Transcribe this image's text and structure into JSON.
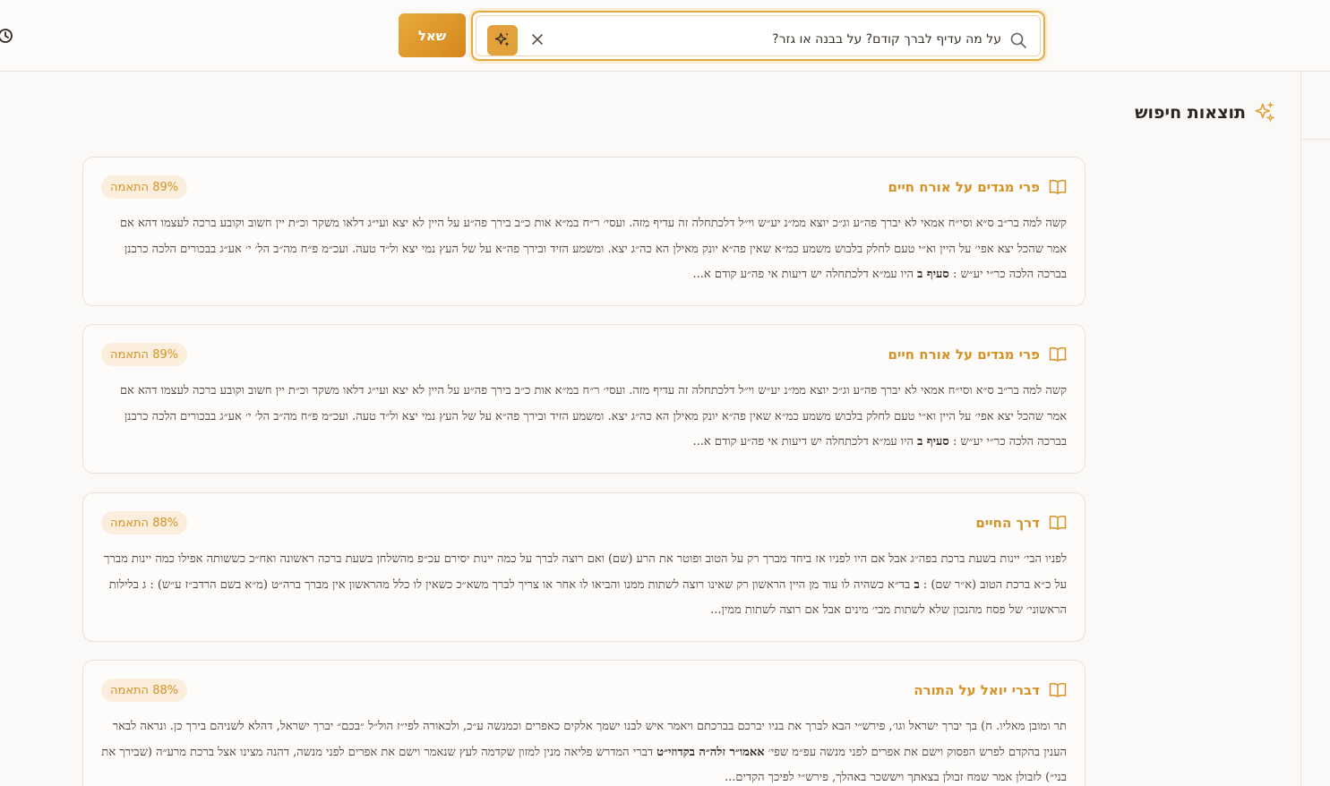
{
  "header": {
    "ask_label": "שאל",
    "search_value": "על מה עדיף לברך קודם? על בבנה או גזר?"
  },
  "results": {
    "title": "תוצאות חיפוש",
    "items": [
      {
        "title": "פרי מגדים על אורח חיים",
        "match": "89% התאמה",
        "snippet_before": "קשה למה בר״ב ס״א וסי״ח אמאי לא יברך פה״ע וג״כ יוצא ממ״נ יע״ש וי״ל דלכתחלה זה עדיף מזה. ועסי׳ ר״ח במ״א אות כ״ב בירך פה״ע על היין לא יצא ועי״ג דלאו משקר וכ״ת יין חשוב וקובע ברכה לעצמו דהא אם אמר שהכל יצא אפי׳ על היין וא״י טעם לחלק בלבוש משמע כמ״א שאין פה״א יונק מאילן הא כה״ג יצא. ומשמע הזיד ובירך פה״א על של העץ נמי יצא ול״ד טעה. ועכ״מ פ״ח מה״ב הל׳ י׳ אע״ג בבכורים הלכה כרבנן בברכה הלכה כר״י יע״ש : ",
        "snippet_bold": "סעיף ב",
        "snippet_after": " היו עמ״א דלכתחלה יש דיעות אי פה״ע קודם א..."
      },
      {
        "title": "פרי מגדים על אורח חיים",
        "match": "89% התאמה",
        "snippet_before": "קשה למה בר״ב ס״א וסי״ח אמאי לא יברך פה״ע וג״כ יוצא ממ״נ יע״ש וי״ל דלכתחלה זה עדיף מזה. ועסי׳ ר״ח במ״א אות כ״ב בירך פה״ע על היין לא יצא ועי״ג דלאו משקר וכ״ת יין חשוב וקובע ברכה לעצמו דהא אם אמר שהכל יצא אפי׳ על היין וא״י טעם לחלק בלבוש משמע כמ״א שאין פה״א יונק מאילן הא כה״ג יצא. ומשמע הזיד ובירך פה״א על של העץ נמי יצא ול״ד טעה. ועכ״מ פ״ח מה״ב הל׳ י׳ אע״ג בבכורים הלכה כרבנן בברכה הלכה כר״י יע״ש : ",
        "snippet_bold": "סעיף ב",
        "snippet_after": " היו עמ״א דלכתחלה יש דיעות אי פה״ע קודם א..."
      },
      {
        "title": "דרך החיים",
        "match": "88% התאמה",
        "snippet_before": "לפניו הבי׳ יינות בשעת ברכת בפה״ג אבל אם היו לפניו אז ביחד מברך רק על הטוב ופוטר את הרע (שם) ואם רוצה לברך על כמה יינות יסירם עכ״פ מהשלחן בשעת ברכה ראשונה ואח״כ כששותה אפילו כמה יינות מברך על כ״א ברכת הטוב (א״ר שם) : ",
        "snippet_bold": "ב",
        "snippet_after": " בד״א כשהיה לו עוד מן היין הראשון רק שאינו רוצה לשתות ממנו והביאו לו אחר או צריך לברך משא״כ כשאין לו כלל מהראשון אין מברך ברה״ט (מ״א בשם הרדב״ז ע״ש) : ג בלילות הראשוני׳ של פסח מהנכון שלא לשתות מבי׳ מינים אבל אם רוצה לשתות ממין..."
      },
      {
        "title": "דברי יואל על התורה",
        "match": "88% התאמה",
        "snippet_before": "תר ומובן מאליו. ח) בך יברך ישראל וגו׳, פירש״י הבא לברך את בניו יברכם בברכתם ויאמר איש לבנו ישמך אלקים כאפרים וכמנשה ע״כ, ולכאורה לפי״ז הול״ל ״בכם״ יברך ישראל, דהלא לשניהם בירך כן. ונראה לבאר הענין בהקדם לפרש הפסוק וישם את אפרים לפני מנשה עפ״מ שפי׳ ",
        "snippet_bold": "אאמו״ר זלה״ה בקדוזי״ט",
        "snippet_after": " דברי המדרש פליאה מנין למזון שקדמה לעץ שנאמר וישם את אפרים לפני מנשה, דהנה מצינו אצל ברכת מרע״ה (שבירך את בני״) לזבולן אמר שמח זבולן בצאתך ויששכר באהלך, פירש״י לפיכך הקדים..."
      }
    ]
  },
  "icons": {
    "history": "history-icon",
    "ai": "sparkles-icon",
    "clear": "close-icon",
    "search": "search-icon",
    "book": "book-icon"
  },
  "colors": {
    "accent": "#e3a13b",
    "accent_dark": "#d4861b",
    "title": "#d69124",
    "badge_bg": "#fbeedc"
  }
}
